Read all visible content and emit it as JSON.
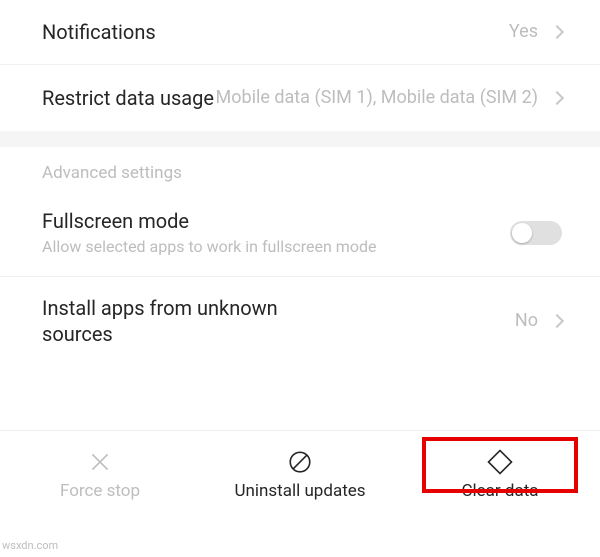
{
  "rows": {
    "notifications": {
      "label": "Notifications",
      "value": "Yes"
    },
    "restrict": {
      "label": "Restrict data usage",
      "value": "Mobile data (SIM 1), Mobile data (SIM 2)"
    },
    "fullscreen": {
      "label": "Fullscreen mode",
      "sub": "Allow selected apps to work in fullscreen mode"
    },
    "unknown": {
      "label": "Install apps from unknown sources",
      "value": "No"
    }
  },
  "section_header": "Advanced settings",
  "actions": {
    "force_stop": "Force stop",
    "uninstall_updates": "Uninstall updates",
    "clear_data": "Clear data"
  },
  "watermark": "wsxdn.com"
}
